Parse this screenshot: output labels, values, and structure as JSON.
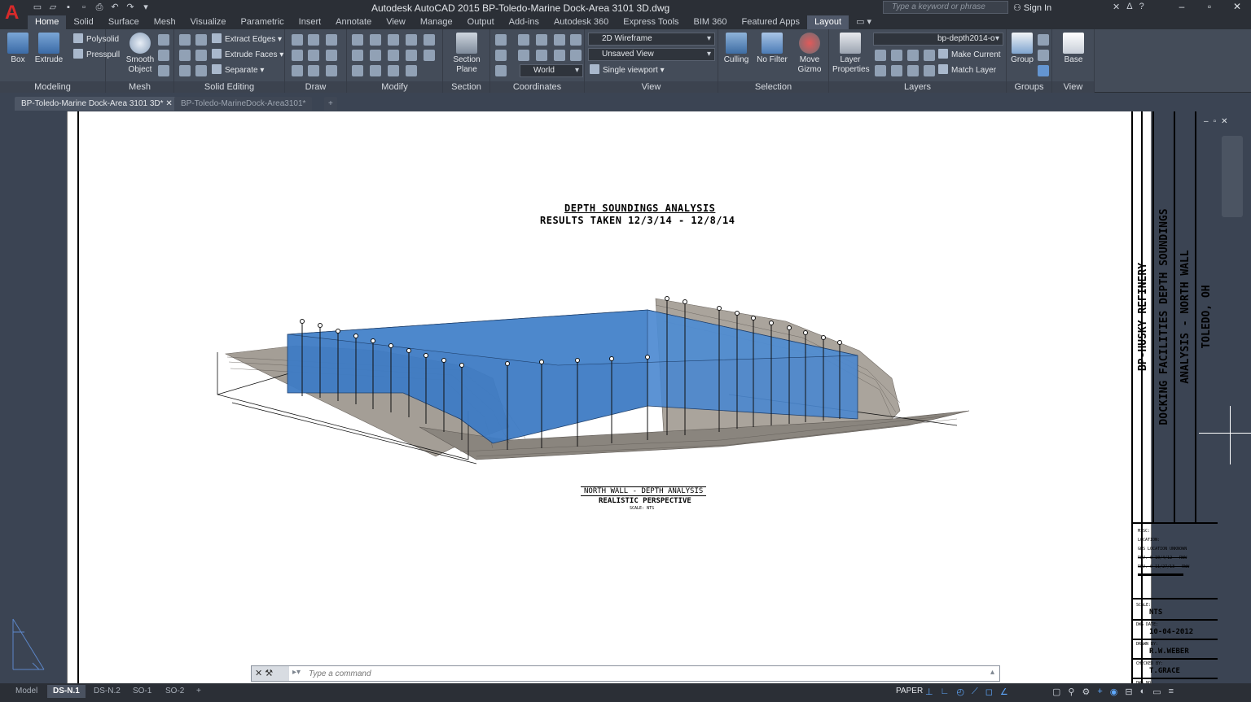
{
  "window": {
    "title": "Autodesk AutoCAD 2015    BP-Toledo-Marine Dock-Area 3101 3D.dwg",
    "search_placeholder": "Type a keyword or phrase",
    "signin": "Sign In"
  },
  "ribbon_tabs": [
    "Home",
    "Solid",
    "Surface",
    "Mesh",
    "Visualize",
    "Parametric",
    "Insert",
    "Annotate",
    "View",
    "Manage",
    "Output",
    "Add-ins",
    "Autodesk 360",
    "Express Tools",
    "BIM 360",
    "Featured Apps",
    "Layout"
  ],
  "ribbon": {
    "modeling": {
      "title": "Modeling",
      "box": "Box",
      "extrude": "Extrude",
      "polysolid": "Polysolid",
      "presspull": "Presspull"
    },
    "mesh": {
      "title": "Mesh",
      "smooth_object": "Smooth Object"
    },
    "solid_editing": {
      "title": "Solid Editing",
      "extract_edges": "Extract Edges",
      "extrude_faces": "Extrude Faces",
      "separate": "Separate"
    },
    "draw": {
      "title": "Draw"
    },
    "modify": {
      "title": "Modify"
    },
    "section": {
      "title": "Section",
      "section_plane": "Section Plane"
    },
    "coordinates": {
      "title": "Coordinates",
      "ucs": "World"
    },
    "view": {
      "title": "View",
      "visual_style": "2D Wireframe",
      "named_view": "Unsaved View",
      "viewport": "Single viewport"
    },
    "selection": {
      "title": "Selection",
      "culling": "Culling",
      "no_filter": "No Filter",
      "move_gizmo": "Move Gizmo"
    },
    "layers": {
      "title": "Layers",
      "layer_properties": "Layer Properties",
      "current_layer": "bp-depth2014-o",
      "make_current": "Make Current",
      "match_layer": "Match Layer"
    },
    "groups": {
      "title": "Groups",
      "group": "Group"
    },
    "view2": {
      "title": "View",
      "base": "Base"
    }
  },
  "doc_tabs": [
    "BP-Toledo-Marine Dock-Area 3101 3D*",
    "BP-Toledo-MarineDock-Area3101*"
  ],
  "drawing": {
    "title_line1": "DEPTH SOUNDINGS ANALYSIS",
    "title_line2": "RESULTS TAKEN 12/3/14 - 12/8/14",
    "caption_line1": "NORTH WALL - DEPTH ANALYSIS",
    "caption_line2": "REALISTIC PERSPECTIVE",
    "caption_scale": "SCALE: NTS"
  },
  "title_block": {
    "col1": "BP-HUSKY REFINERY",
    "col2": "DOCKING FACILITIES DEPTH SOUNDINGS",
    "col3": "ANALYSIS - NORTH WALL",
    "col4": "TOLEDO, OH",
    "notes": [
      "MISC:",
      "LOCATION:",
      "GPS LOCATION UNKNOWN",
      "REV. 0 10/4/12 - RWW",
      "REV. 0 11/27/13 - RWW"
    ],
    "scale_label": "SCALE:",
    "scale_value": "NTS",
    "date_label": "DWG DATE:",
    "date_value": "10-04-2012",
    "drawn_label": "DRAWN BY:",
    "drawn_value": "R.W.WEBER",
    "checked_label": "CHECKED BY:",
    "checked_value": "T.GRACE",
    "dwg_label": "DWG NO:"
  },
  "command": {
    "placeholder": "Type a command"
  },
  "layout_tabs": [
    "Model",
    "DS-N.1",
    "DS-N.2",
    "SO-1",
    "SO-2"
  ],
  "status": {
    "paper": "PAPER"
  },
  "colors": {
    "water": "#3e7bc4",
    "terrain": "#9a948d",
    "ui_dark": "#2b2f36",
    "ribbon": "#444c59"
  }
}
